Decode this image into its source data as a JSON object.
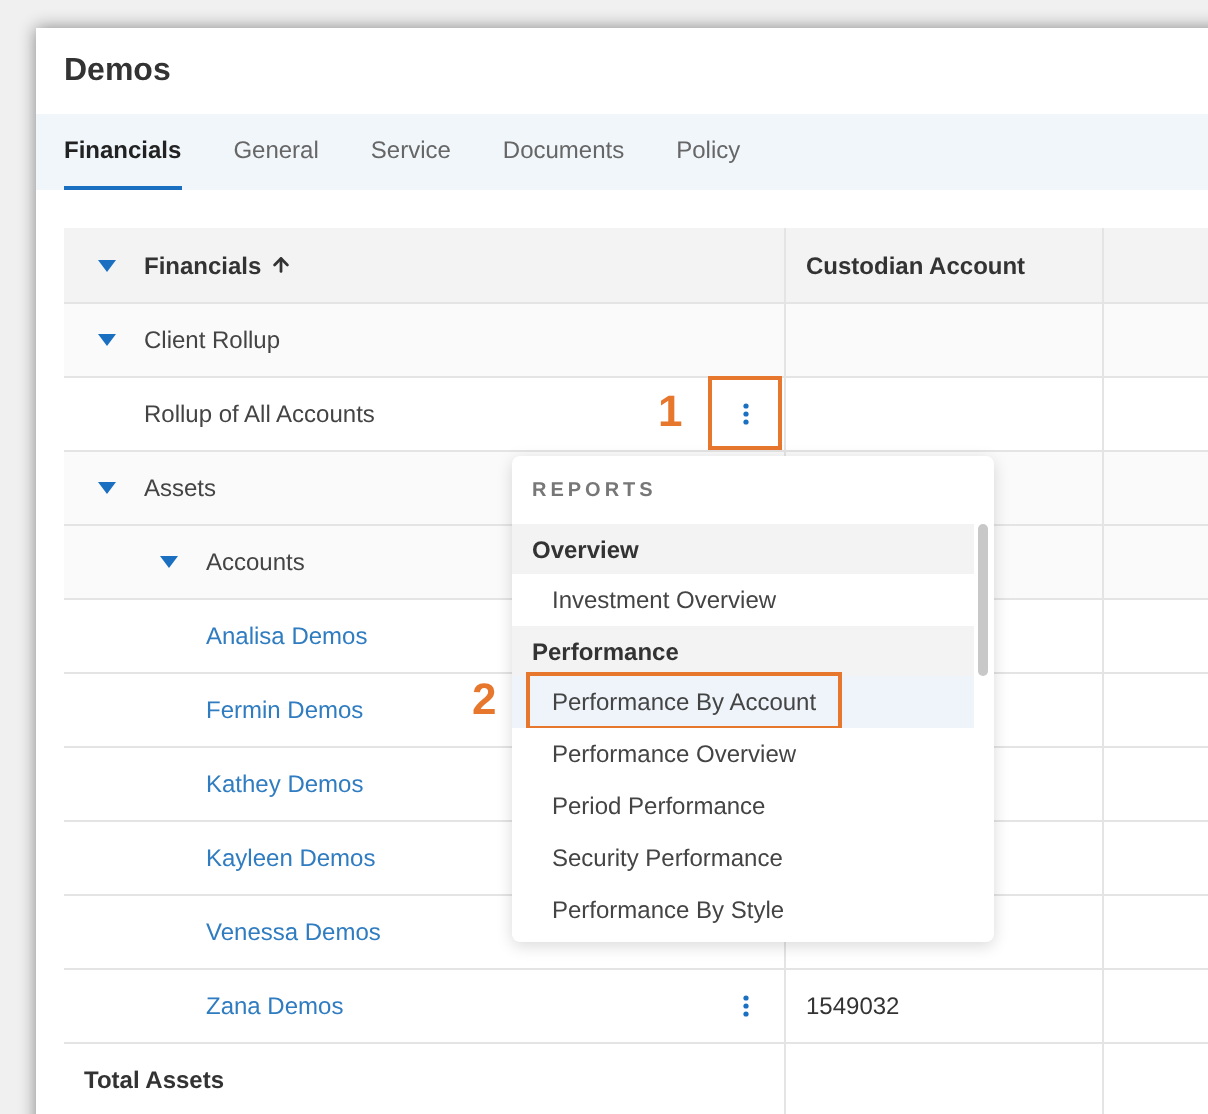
{
  "window": {
    "title": "Demos"
  },
  "tabs": [
    {
      "label": "Financials",
      "selected": true
    },
    {
      "label": "General",
      "selected": false
    },
    {
      "label": "Service",
      "selected": false
    },
    {
      "label": "Documents",
      "selected": false
    },
    {
      "label": "Policy",
      "selected": false
    }
  ],
  "table": {
    "columns": [
      {
        "label": "Financials",
        "expanded": true,
        "sort_ascending": true
      },
      {
        "label": "Custodian Account"
      }
    ],
    "rows": [
      {
        "label": "Client Rollup",
        "kind": "group",
        "expanded": true,
        "children": [
          {
            "label": "Rollup of All Accounts",
            "kind": "item",
            "menu_button": true,
            "callout": "1"
          }
        ]
      },
      {
        "label": "Assets",
        "kind": "group",
        "expanded": true,
        "children": [
          {
            "label": "Accounts",
            "kind": "group",
            "expanded": true,
            "children": [
              {
                "label": "Analisa Demos",
                "kind": "link"
              },
              {
                "label": "Fermin Demos",
                "kind": "link"
              },
              {
                "label": "Kathey Demos",
                "kind": "link"
              },
              {
                "label": "Kayleen Demos",
                "kind": "link"
              },
              {
                "label": "Venessa Demos",
                "kind": "link"
              },
              {
                "label": "Zana Demos",
                "kind": "link",
                "menu_button": true,
                "custodian_account": "1549032"
              }
            ]
          }
        ]
      },
      {
        "label": "Total Assets",
        "kind": "total"
      }
    ]
  },
  "menu": {
    "heading": "REPORTS",
    "sections": [
      {
        "title": "Overview",
        "items": [
          {
            "label": "Investment Overview",
            "selected": false
          }
        ]
      },
      {
        "title": "Performance",
        "items": [
          {
            "label": "Performance By Account",
            "selected": true,
            "callout": "2"
          },
          {
            "label": "Performance Overview",
            "selected": false
          },
          {
            "label": "Period Performance",
            "selected": false
          },
          {
            "label": "Security Performance",
            "selected": false
          },
          {
            "label": "Performance By Style",
            "selected": false
          }
        ]
      }
    ]
  }
}
